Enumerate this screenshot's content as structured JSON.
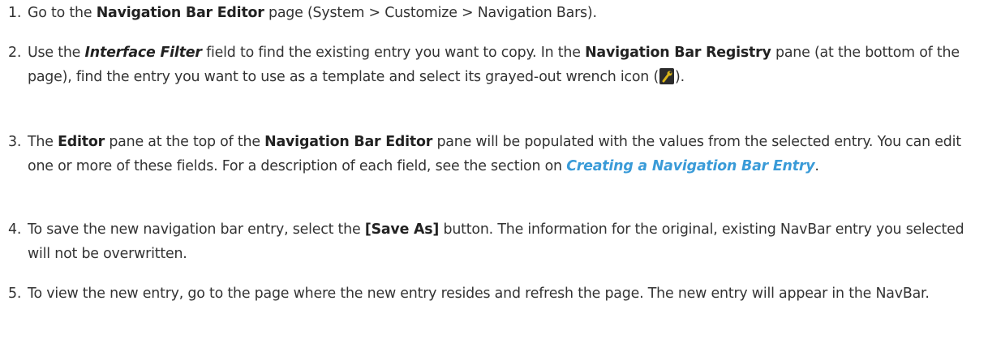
{
  "steps": [
    {
      "number": "1.",
      "p1": "Go to the ",
      "b1": "Navigation Bar Editor",
      "p2": " page (System > Customize > Navigation Bars)."
    },
    {
      "number": "2.",
      "p1": "Use the ",
      "bi1": "Interface Filter",
      "p2": " field to find the existing entry you want to copy. In the ",
      "b1": "Navigation Bar Registry",
      "p3": " pane (at the bottom of the page), find the entry you want to use as a template and select its grayed-out wrench icon (",
      "icon": "wrench-icon",
      "p4": ")."
    },
    {
      "number": "3.",
      "p1": "The ",
      "b1": "Editor",
      "p2": " pane at the top of the ",
      "b2": "Navigation Bar Editor",
      "p3": " pane will be populated with the values from the selected entry. You can edit one or more of these fields. For a description of each field, see the section on ",
      "link": "Creating a Navigation Bar Entry",
      "p4": "."
    },
    {
      "number": "4.",
      "p1": "To save the new navigation bar entry, select the ",
      "b1": "[Save As]",
      "p2": " button. The information for the original, existing NavBar entry you selected will not be overwritten."
    },
    {
      "number": "5.",
      "p1": "To view the new entry, go to the page where the new entry resides and refresh the page. The new entry will appear in the NavBar."
    }
  ],
  "colors": {
    "text": "#333333",
    "link": "#3a9bd8",
    "icon_bg": "#2b2b2b",
    "icon_fg": "#d8b418"
  }
}
